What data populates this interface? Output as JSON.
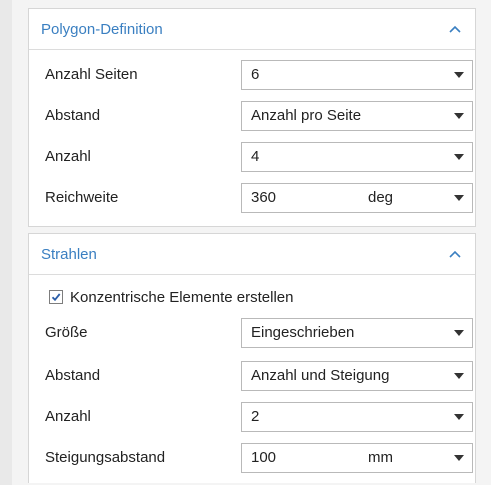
{
  "polygon": {
    "title": "Polygon-Definition",
    "fields": [
      {
        "label": "Anzahl Seiten",
        "value": "6",
        "unit": ""
      },
      {
        "label": "Abstand",
        "value": "Anzahl pro Seite",
        "unit": ""
      },
      {
        "label": "Anzahl",
        "value": "4",
        "unit": ""
      },
      {
        "label": "Reichweite",
        "value": "360",
        "unit": "deg"
      }
    ]
  },
  "strahlen": {
    "title": "Strahlen",
    "checkbox": {
      "label": "Konzentrische Elemente erstellen",
      "checked": true
    },
    "fields": [
      {
        "label": "Größe",
        "value": "Eingeschrieben",
        "unit": ""
      },
      {
        "label": "Abstand",
        "value": "Anzahl und Steigung",
        "unit": ""
      },
      {
        "label": "Anzahl",
        "value": "2",
        "unit": ""
      },
      {
        "label": "Steigungsabstand",
        "value": "100",
        "unit": "mm"
      }
    ]
  },
  "colors": {
    "section_title": "#3a7fc1",
    "background": "#f4f4f4"
  },
  "icons": {
    "collapse": "chevron-up-icon",
    "dropdown": "dropdown-arrow-icon",
    "check": "checkmark-icon"
  }
}
